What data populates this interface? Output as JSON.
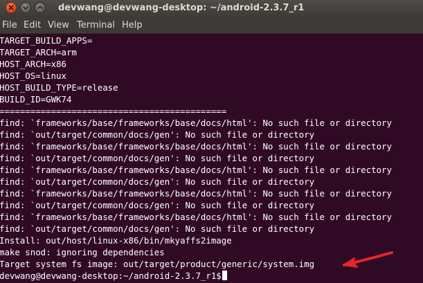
{
  "window": {
    "title": "devwang@devwang-desktop: ~/android-2.3.7_r1"
  },
  "menu": [
    "File",
    "Edit",
    "View",
    "Terminal",
    "Help"
  ],
  "terminal": {
    "lines": [
      "TARGET_BUILD_APPS=",
      "TARGET_ARCH=arm",
      "HOST_ARCH=x86",
      "HOST_OS=linux",
      "HOST_BUILD_TYPE=release",
      "BUILD_ID=GWK74",
      "============================================",
      "find: `frameworks/base/frameworks/base/docs/html': No such file or directory",
      "find: `out/target/common/docs/gen': No such file or directory",
      "find: `frameworks/base/frameworks/base/docs/html': No such file or directory",
      "find: `out/target/common/docs/gen': No such file or directory",
      "find: `frameworks/base/frameworks/base/docs/html': No such file or directory",
      "find: `out/target/common/docs/gen': No such file or directory",
      "find: `frameworks/base/frameworks/base/docs/html': No such file or directory",
      "find: `out/target/common/docs/gen': No such file or directory",
      "find: `frameworks/base/frameworks/base/docs/html': No such file or directory",
      "find: `out/target/common/docs/gen': No such file or directory",
      "Install: out/host/linux-x86/bin/mkyaffs2image",
      "make snod: ignoring dependencies",
      "Target system fs image: out/target/product/generic/system.img"
    ],
    "prompt": "devwang@devwang-desktop:~/android-2.3.7_r1$"
  },
  "colors": {
    "terminal_bg": "#300a24",
    "terminal_fg": "#ffffff",
    "titlebar_bg": "#3c3b37",
    "close_button": "#dd4814",
    "annotation_arrow": "#e8252a"
  },
  "icons": {
    "close": "close-icon",
    "minimize": "minimize-icon",
    "maximize": "maximize-icon",
    "annotation": "red-arrow-annotation"
  }
}
